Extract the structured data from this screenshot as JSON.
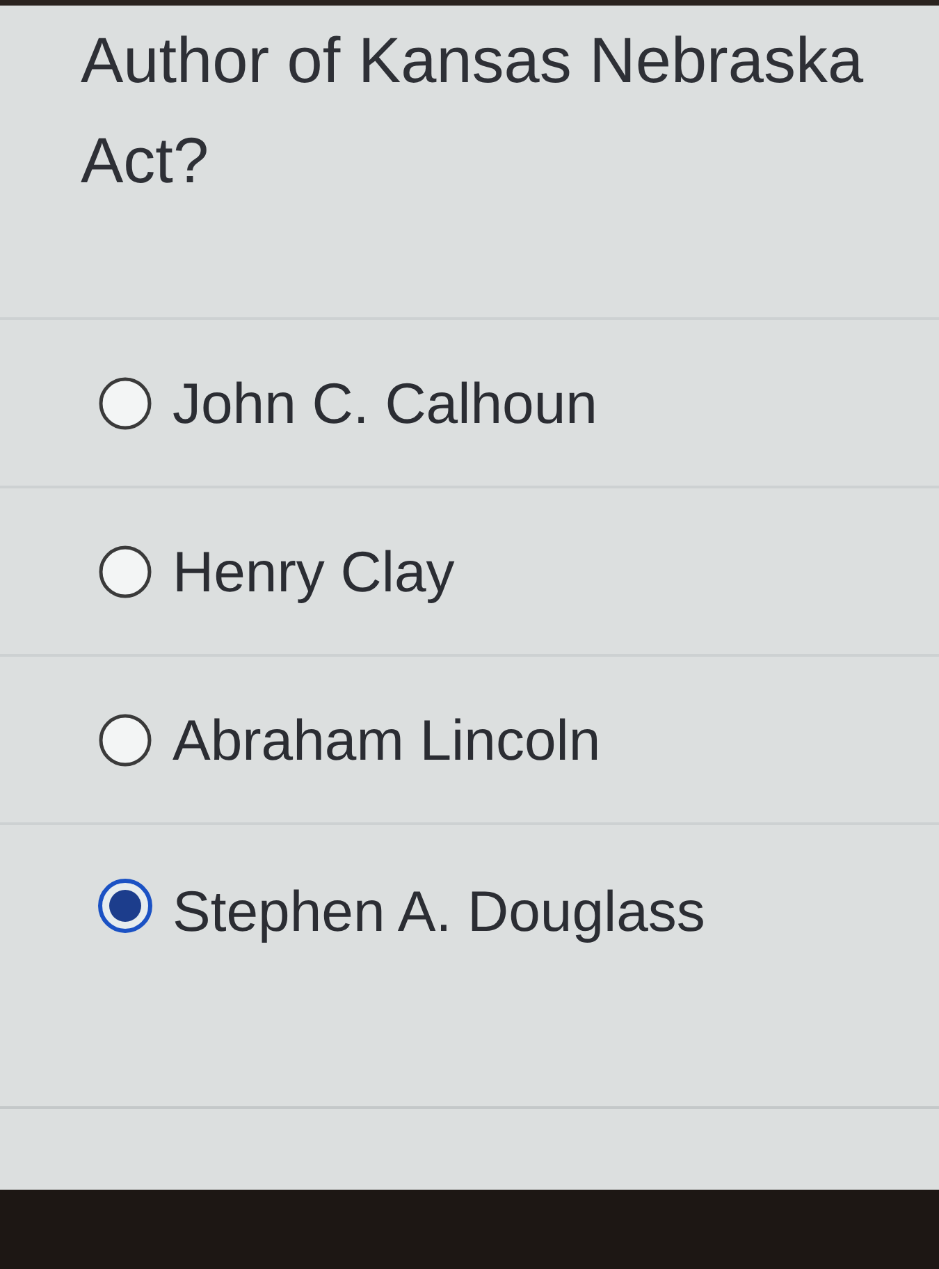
{
  "question": {
    "text": "Author of Kansas Nebraska Act?"
  },
  "options": [
    {
      "label": "John C. Calhoun",
      "selected": false
    },
    {
      "label": "Henry Clay",
      "selected": false
    },
    {
      "label": "Abraham Lincoln",
      "selected": false
    },
    {
      "label": "Stephen A. Douglass",
      "selected": true
    }
  ]
}
